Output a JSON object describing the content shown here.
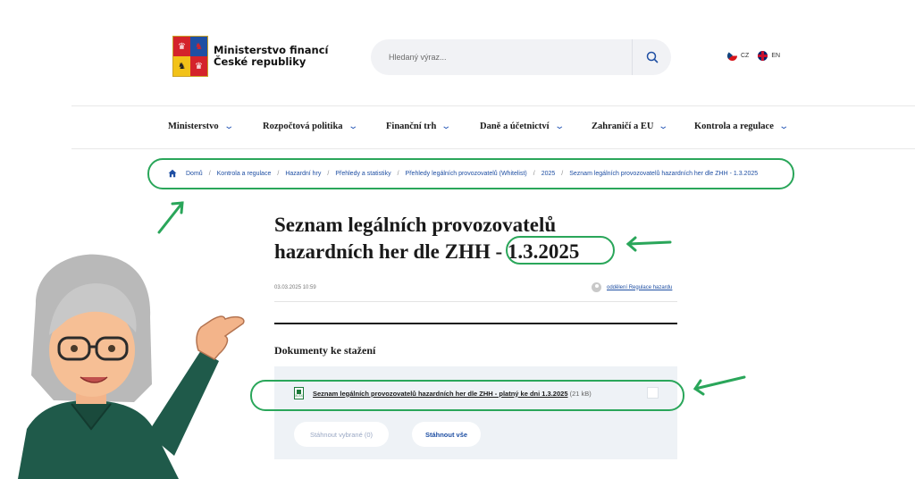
{
  "header": {
    "logo_line1": "Ministerstvo financí",
    "logo_line2": "České republiky",
    "search_placeholder": "Hledaný výraz...",
    "langs": [
      {
        "code": "CZ",
        "icon": "czech-flag-icon"
      },
      {
        "code": "EN",
        "icon": "uk-flag-icon"
      }
    ]
  },
  "nav": {
    "items": [
      "Ministerstvo",
      "Rozpočtová politika",
      "Finanční trh",
      "Daně a účetnictví",
      "Zahraničí a EU",
      "Kontrola a regulace"
    ]
  },
  "breadcrumb": [
    "Domů",
    "Kontrola a regulace",
    "Hazardní hry",
    "Přehledy a statistiky",
    "Přehledy legálních provozovatelů (Whitelist)",
    "2025",
    "Seznam legálních provozovatelů hazardních her dle ZHH - 1.3.2025"
  ],
  "article": {
    "title_line1": "Seznam legálních provozovatelů",
    "title_line2": "hazardních her dle ZHH - 1.3.2025",
    "date": "03.03.2025 10:59",
    "author": "oddělení Regulace hazardu"
  },
  "documents": {
    "heading": "Dokumenty ke stažení",
    "file_icon_label": "XLSX",
    "file_name": "Seznam legálních provozovatelů hazardních her dle ZHH - platný ke dni 1.3.2025",
    "file_size": "(21 kB)",
    "btn_selected": "Stáhnout vybrané (0)",
    "btn_all": "Stáhnout vše"
  },
  "colors": {
    "accent": "#1f4fa3",
    "highlight": "#2aa65a"
  }
}
